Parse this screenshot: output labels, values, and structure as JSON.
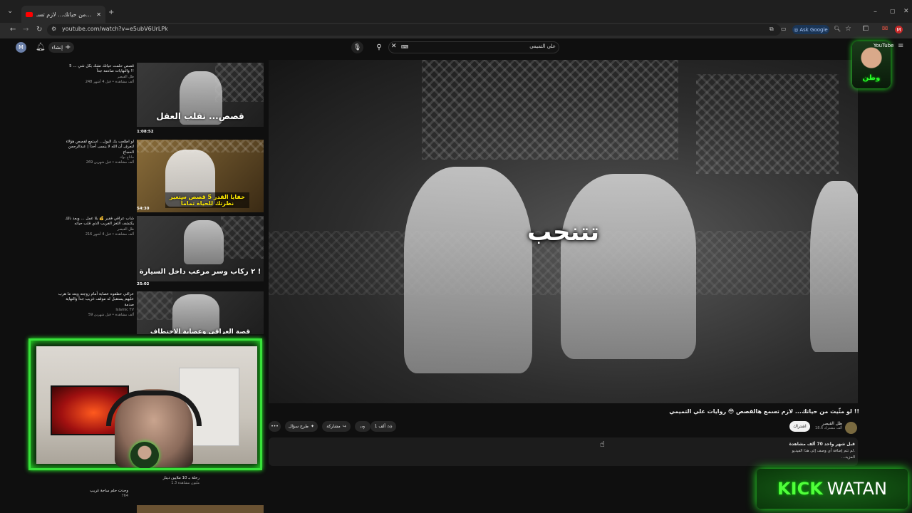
{
  "browser": {
    "tab_title": "لو مثّيت من حياتك... لازم تسـ...",
    "url": "youtube.com/watch?v=e5ubV6UrLPk",
    "ask_google": "Ask Google"
  },
  "header": {
    "avatar_letter": "M",
    "create_label": "إنشاء",
    "search_value": "علي التميمي"
  },
  "sidebar": {
    "items": [
      {
        "title": "5 قصص حلمت حياتك تشك بكل شي ... والنهايات صادمة جداً !!",
        "channel": "ظل القيصر",
        "meta": "248 ألف مشاهدة • قبل 4 أشهر",
        "thumb_caption": "قصص... تقلب العقل"
      },
      {
        "title": "لو اطلعت بك البول... استمع لقصص هؤلاء لتعرف أن الله لا ينسى أحداً | عبدالرحمن الحجاج",
        "channel": "ماتاج بوك",
        "meta": "269 ألف مشاهدة • قبل شهرين",
        "thumb_caption": "خفايا القدر 5 قصص ستغير نظرتك للحياة تماماً",
        "duration": "1:08:52"
      },
      {
        "title": "شاب عراقي فقير 💰 بلا عمل ... وبعد ذلك يكتشف اللغز الغريب الذي قلب حياته",
        "channel": "ظل القيصر",
        "meta": "216 ألف مشاهدة • قبل 4 أشهر",
        "thumb_caption": "٢ ركاب وسر مرعب داخل السيارة !",
        "duration": "54:30"
      },
      {
        "title": "عراقي خطفوه عصابة أمام زوجته وبعد ما هرب عليهم يستقبل له موقف غريب جداً والنهاية صدمة",
        "channel": "Islamic TV",
        "meta": "59 ألف مشاهدة • قبل شهرين",
        "thumb_caption": "قصة العراقي وعصابة الاختطاف",
        "duration": "25:02"
      }
    ],
    "bottom_items": [
      {
        "text": "رحلة بـ 10 ملايين دينار",
        "meta": "1.3 مليون مشاهدة"
      },
      {
        "text": "وجدت حلم ساحة غريب",
        "meta": "764"
      }
    ]
  },
  "video": {
    "subtitle": "تتنحب",
    "title": "لو مثّيت من حياتك... لازم تسمع هالقصص 😳 روايات علي التميمي !!",
    "channel_name": "ظل القيصر",
    "subscribers": "18.6 ألف مشترك",
    "subscribe_label": "اشتراك",
    "like_count": "1 ألف",
    "share_label": "مشاركة",
    "ask_label": "طرح سؤال",
    "more_label": "•••",
    "views": "70 ألف مشاهدة",
    "date": "قبل شهر واحد",
    "description": "لم تتم إضافة أي وصف إلى هذا الفيديو.",
    "more_text": "...المزيد"
  },
  "overlay": {
    "logo_text": "وطن",
    "yt_text": "YouTube",
    "kick_word": "KICK",
    "watan_word": "WATAN"
  }
}
